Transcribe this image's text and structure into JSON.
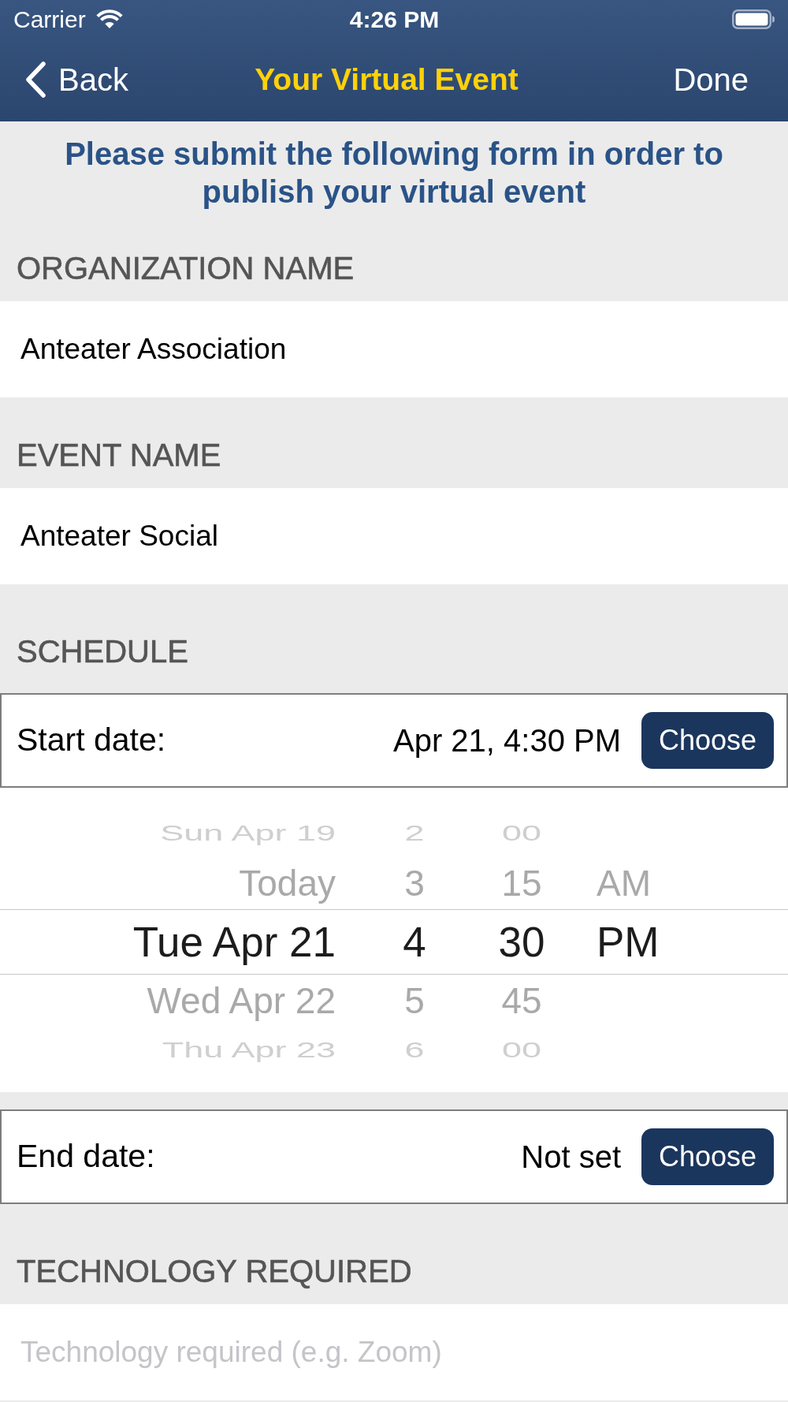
{
  "status_bar": {
    "carrier": "Carrier",
    "time": "4:26 PM"
  },
  "nav_bar": {
    "back": "Back",
    "title": "Your Virtual Event",
    "done": "Done"
  },
  "intro": "Please submit the following form in order to publish your virtual event",
  "sections": [
    {
      "kind": "text",
      "header": "ORGANIZATION NAME",
      "value": "Anteater Association"
    },
    {
      "kind": "text",
      "header": "EVENT NAME",
      "value": "Anteater Social"
    },
    {
      "kind": "schedule",
      "header": "SCHEDULE",
      "dates": [
        {
          "label": "Start date:",
          "value": "Apr 21, 4:30 PM",
          "button": "Choose",
          "picker": {
            "rows": [
              {
                "date": "Sun Apr 19",
                "hour": "2",
                "minute": "00",
                "selected": false
              },
              {
                "date": "Today",
                "hour": "3",
                "minute": "15",
                "period": "AM",
                "selected": false
              },
              {
                "date": "Tue Apr 21",
                "hour": "4",
                "minute": "30",
                "period": "PM",
                "selected": true
              },
              {
                "date": "Wed Apr 22",
                "hour": "5",
                "minute": "45",
                "selected": false
              },
              {
                "date": "Thu Apr 23",
                "hour": "6",
                "minute": "00",
                "selected": false
              }
            ]
          }
        },
        {
          "label": "End date:",
          "value": "Not set",
          "button": "Choose"
        }
      ]
    },
    {
      "kind": "text",
      "header": "TECHNOLOGY REQUIRED",
      "placeholder": "Technology required (e.g. Zoom)"
    }
  ]
}
